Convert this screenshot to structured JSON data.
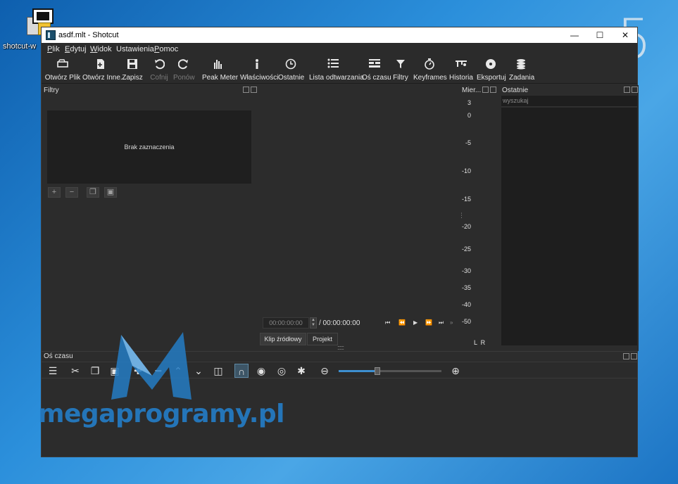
{
  "desktop": {
    "icon_label": "shotcut-w",
    "corner_number": "5"
  },
  "window": {
    "title": "asdf.mlt - Shotcut",
    "controls": {
      "minimize": "—",
      "maximize": "☐",
      "close": "✕"
    }
  },
  "menu": [
    {
      "underline": "P",
      "rest": "lik"
    },
    {
      "underline": "E",
      "rest": "dytuj"
    },
    {
      "underline": "W",
      "rest": "idok"
    },
    {
      "underline": "",
      "rest": "Ustawienia"
    },
    {
      "underline": "P",
      "rest": "omoc"
    }
  ],
  "toolbar": {
    "open_file": "Otwórz Plik",
    "open_other": "Otwórz Inne...",
    "save": "Zapisz",
    "undo": "Cofnij",
    "redo": "Ponów",
    "peak_meter": "Peak Meter",
    "properties": "Właściwości",
    "recent": "Ostatnie",
    "playlist": "Lista odtwarzania",
    "timeline": "Oś czasu",
    "filters": "Filtry",
    "keyframes": "Keyframes",
    "history": "Historia",
    "export": "Eksportuj",
    "jobs": "Zadania"
  },
  "filters_panel": {
    "title": "Filtry",
    "empty_text": "Brak zaznaczenia"
  },
  "player": {
    "timecode": "00:00:00:00",
    "duration": "/ 00:00:00:00",
    "tabs": [
      "Klip źródłowy",
      "Projekt"
    ]
  },
  "meter_panel": {
    "title": "Mier...",
    "scale": [
      "3",
      "0",
      "-5",
      "-10",
      "-15",
      "-20",
      "-25",
      "-30",
      "-35",
      "-40",
      "-50"
    ],
    "channels": "L  R"
  },
  "recent_panel": {
    "title": "Ostatnie",
    "search_placeholder": "wyszukaj"
  },
  "timeline_panel": {
    "title": "Oś czasu",
    "zoom_level": 0.38
  },
  "watermark": {
    "text": "megaprogramy.pl"
  },
  "colors": {
    "accent": "#3d8fd0",
    "panel_bg": "#2c2c2c",
    "watermark": "#247cc4"
  }
}
